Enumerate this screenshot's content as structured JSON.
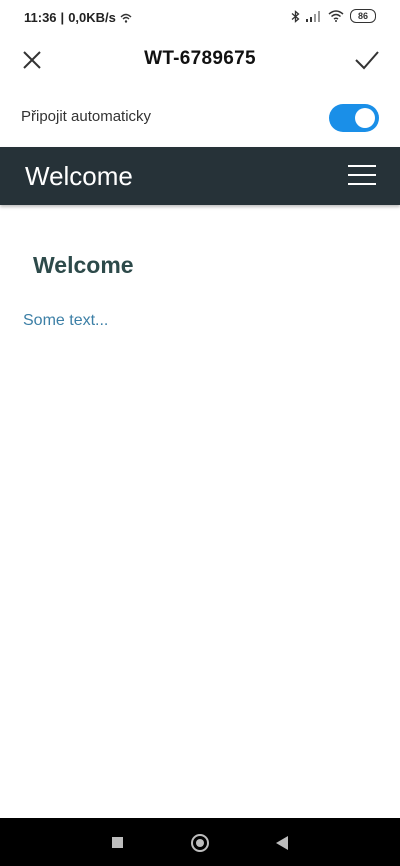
{
  "status_bar": {
    "time": "11:36",
    "network_speed": "0,0KB/s",
    "battery": "86"
  },
  "title_bar": {
    "title": "WT-6789675",
    "close_icon": "close-icon",
    "confirm_icon": "check-icon"
  },
  "auto_connect": {
    "label": "Připojit automaticky",
    "enabled": true,
    "accent_color": "#1a8fe8"
  },
  "web_header": {
    "title": "Welcome",
    "background": "#263238",
    "menu_icon": "hamburger-menu-icon"
  },
  "content": {
    "heading": "Welcome",
    "text": "Some text..."
  },
  "navigation_bar": {
    "recents_icon": "square-icon",
    "home_icon": "circle-icon",
    "back_icon": "triangle-back-icon"
  }
}
